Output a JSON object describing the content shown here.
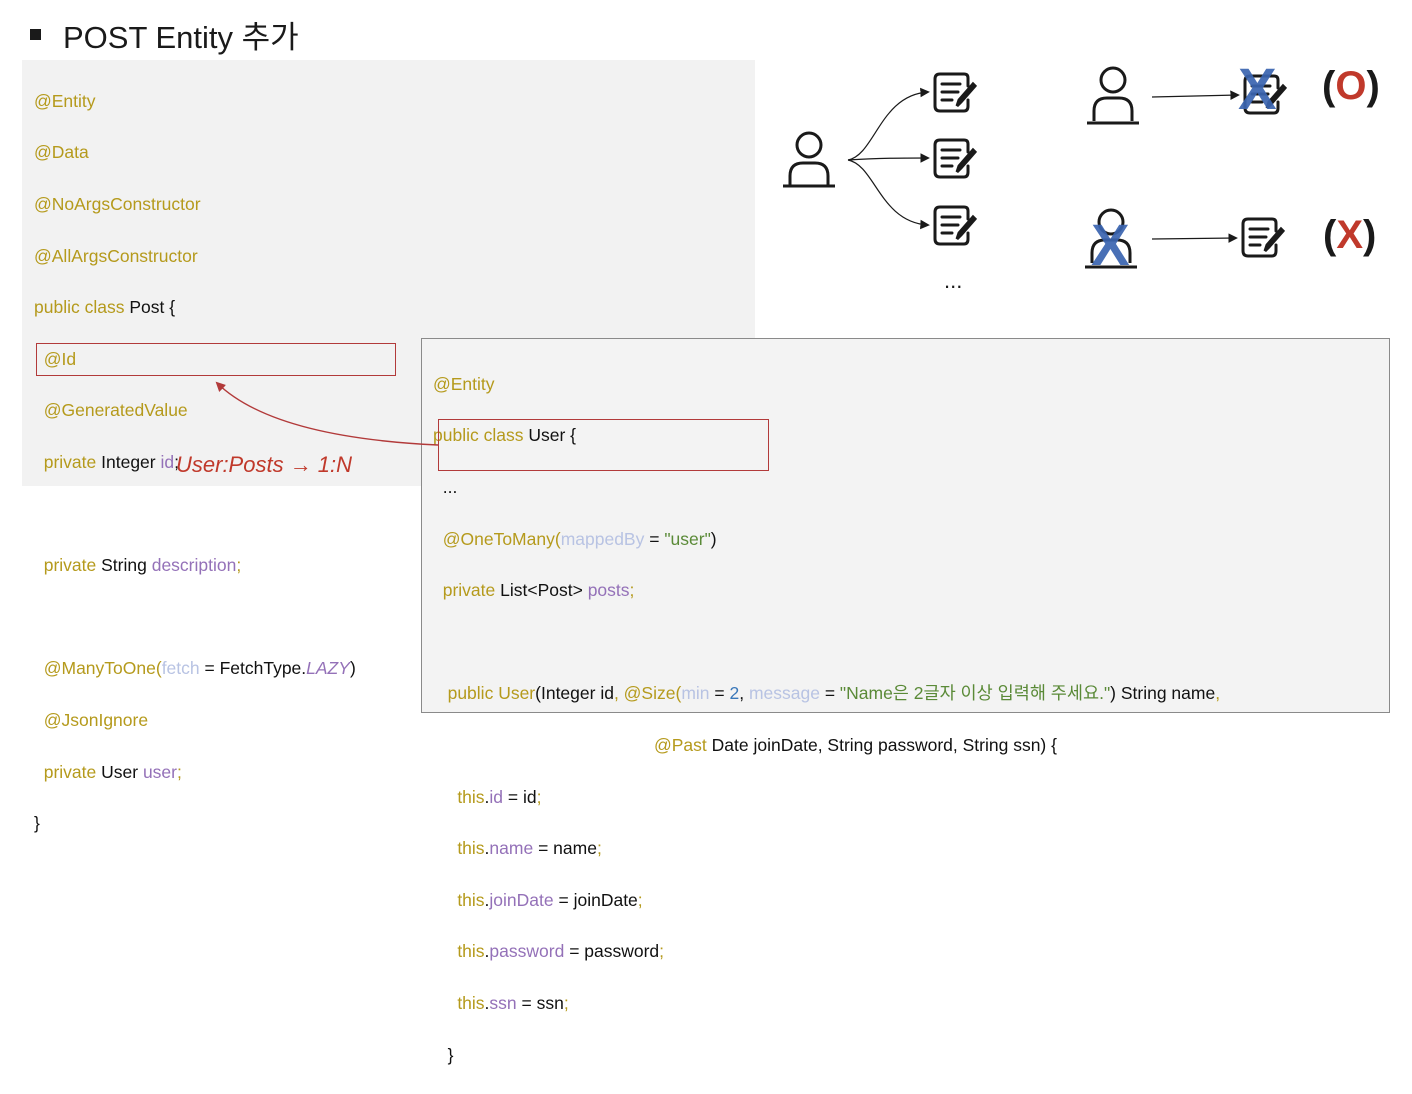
{
  "title": "POST Entity 추가",
  "post_code": {
    "anno_entity": "@Entity",
    "anno_data": "@Data",
    "anno_noargs": "@NoArgsConstructor",
    "anno_allargs": "@AllArgsConstructor",
    "class_kw": "public class",
    "class_rest": " Post {",
    "anno_id": "@Id",
    "anno_gen": "@GeneratedValue",
    "id_kw": "private",
    "id_type": " Integer ",
    "id_name": "id",
    "id_semi": ";",
    "desc_kw": "private",
    "desc_type": " String ",
    "desc_name": "description",
    "desc_semi": ";",
    "m2o_anno": "@ManyToOne(",
    "m2o_param": "fetch",
    "m2o_eq": " = FetchType.",
    "m2o_lazy": "LAZY",
    "m2o_close": ")",
    "jsonignore": "@JsonIgnore",
    "user_kw": "private",
    "user_type": " User ",
    "user_name": "user",
    "user_semi": ";",
    "close_brace": "}"
  },
  "relation_label": "User:Posts → 1:N",
  "user_code": {
    "anno_entity": "@Entity",
    "class_kw": "public class",
    "class_rest": " User {",
    "ellipsis": "...",
    "o2m_anno": "@OneToMany(",
    "o2m_param": "mappedBy",
    "o2m_eq": " = ",
    "o2m_value": "\"user\"",
    "o2m_close": ")",
    "posts_kw": "private",
    "posts_type": " List<Post> ",
    "posts_name": "posts",
    "posts_semi": ";",
    "ctor_kw": "public ",
    "ctor_name": "User",
    "ctor_p1": "(Integer id",
    "ctor_comma": ", ",
    "ctor_size": "@Size(",
    "ctor_min": "min",
    "ctor_eq1": " = ",
    "ctor_two": "2",
    "ctor_comma2": ", ",
    "ctor_message": "message",
    "ctor_eq2": " = ",
    "ctor_msgval": "\"Name은 2글자 이상 입력해 주세요.\"",
    "ctor_p2": ") String name",
    "ctor_comma3": ",",
    "ctor2_past": "@Past",
    "ctor2_rest": " Date joinDate, String password, String ssn) {",
    "this1_this": "this",
    "this1_dot": ".",
    "this1_field": "id",
    "this1_rest": " = id",
    "this1_semi": ";",
    "this2_this": "this",
    "this2_dot": ".",
    "this2_field": "name",
    "this2_rest": " = name",
    "this2_semi": ";",
    "this3_this": "this",
    "this3_dot": ".",
    "this3_field": "joinDate",
    "this3_rest": " = joinDate",
    "this3_semi": ";",
    "this4_this": "this",
    "this4_dot": ".",
    "this4_field": "password",
    "this4_rest": " = password",
    "this4_semi": ";",
    "this5_this": "this",
    "this5_dot": ".",
    "this5_field": "ssn",
    "this5_rest": " = ssn",
    "this5_semi": ";",
    "close_brace": "}"
  },
  "diagram": {
    "ellipsis": "...",
    "valid_mark_open": "(",
    "valid_mark_inner": "O",
    "valid_mark_close": ")",
    "invalid_mark_open": "(",
    "invalid_mark_inner": "X",
    "invalid_mark_close": ")",
    "strike_glyph": "X"
  },
  "colors": {
    "annotation": "#b59a1c",
    "field": "#9471b8",
    "param": "#b8c3e3",
    "string": "#5a8a37",
    "highlight_box": "#b23a3a",
    "relation_label": "#c0392b",
    "strike": "#3a64b0"
  }
}
